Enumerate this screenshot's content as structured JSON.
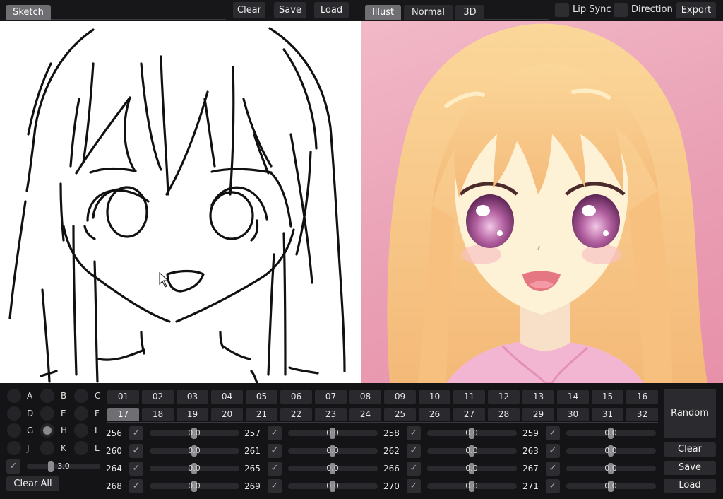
{
  "topbar": {
    "sketch_tab": "Sketch",
    "clear": "Clear",
    "save": "Save",
    "load": "Load",
    "view_tabs": [
      "Illust",
      "Normal",
      "3D"
    ],
    "lip_sync": "Lip Sync",
    "direction": "Direction",
    "export": "Export"
  },
  "groups": [
    "A",
    "B",
    "C",
    "D",
    "E",
    "F",
    "G",
    "H",
    "I",
    "J",
    "K",
    "L"
  ],
  "selected_group": "H",
  "brush_size": "3.0",
  "clear_all": "Clear All",
  "pages_row1": [
    "01",
    "02",
    "03",
    "04",
    "05",
    "06",
    "07",
    "08",
    "09",
    "10",
    "11",
    "12",
    "13",
    "14",
    "15",
    "16"
  ],
  "pages_row2": [
    "17",
    "18",
    "19",
    "20",
    "21",
    "22",
    "23",
    "24",
    "25",
    "26",
    "27",
    "28",
    "29",
    "30",
    "31",
    "32"
  ],
  "selected_page": "17",
  "params": [
    {
      "index": "256",
      "value": "0.0"
    },
    {
      "index": "257",
      "value": "0.0"
    },
    {
      "index": "258",
      "value": "0.0"
    },
    {
      "index": "259",
      "value": "0.0"
    },
    {
      "index": "260",
      "value": "0.0"
    },
    {
      "index": "261",
      "value": "0.0"
    },
    {
      "index": "262",
      "value": "0.0"
    },
    {
      "index": "263",
      "value": "0.0"
    },
    {
      "index": "264",
      "value": "0.0"
    },
    {
      "index": "265",
      "value": "0.0"
    },
    {
      "index": "266",
      "value": "0.0"
    },
    {
      "index": "267",
      "value": "0.0"
    },
    {
      "index": "268",
      "value": "0.0"
    },
    {
      "index": "269",
      "value": "0.0"
    },
    {
      "index": "270",
      "value": "0.0"
    },
    {
      "index": "271",
      "value": "0.0"
    }
  ],
  "side": {
    "random": "Random",
    "clear": "Clear",
    "save": "Save",
    "load": "Load"
  },
  "colors": {
    "accent": "#6f6f73",
    "panel_bg": "#141416",
    "button_bg": "#2b2b2f",
    "illust_bg": "#f2b9c8",
    "hair": "#f6c489"
  }
}
